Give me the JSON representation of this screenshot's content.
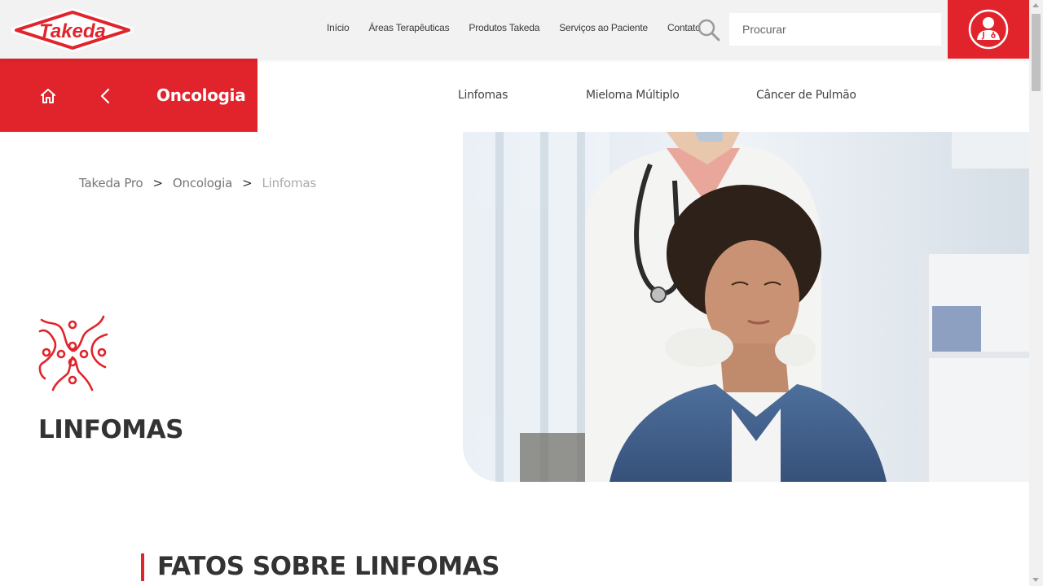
{
  "header": {
    "logo_text": "Takeda",
    "nav": [
      "Início",
      "Áreas Terapêuticas",
      "Produtos Takeda",
      "Serviços ao Paciente",
      "Contato"
    ],
    "search_placeholder": "Procurar",
    "pro_icon": "doctor-icon"
  },
  "section": {
    "title": "Oncologia",
    "home_icon": "home-icon",
    "back_icon": "chevron-left-icon",
    "subnav": [
      "Linfomas",
      "Mieloma Múltiplo",
      "Câncer de Pulmão"
    ]
  },
  "breadcrumb": {
    "items": [
      "Takeda Pro",
      "Oncologia",
      "Linfomas"
    ],
    "separator": ">"
  },
  "hero": {
    "icon": "lymphoma-cell-icon",
    "title": "LINFOMAS"
  },
  "facts": {
    "title": "FATOS SOBRE LINFOMAS"
  },
  "colors": {
    "brand_red": "#e1242b",
    "header_bg": "#f2f2f2",
    "text_dark": "#333333"
  }
}
